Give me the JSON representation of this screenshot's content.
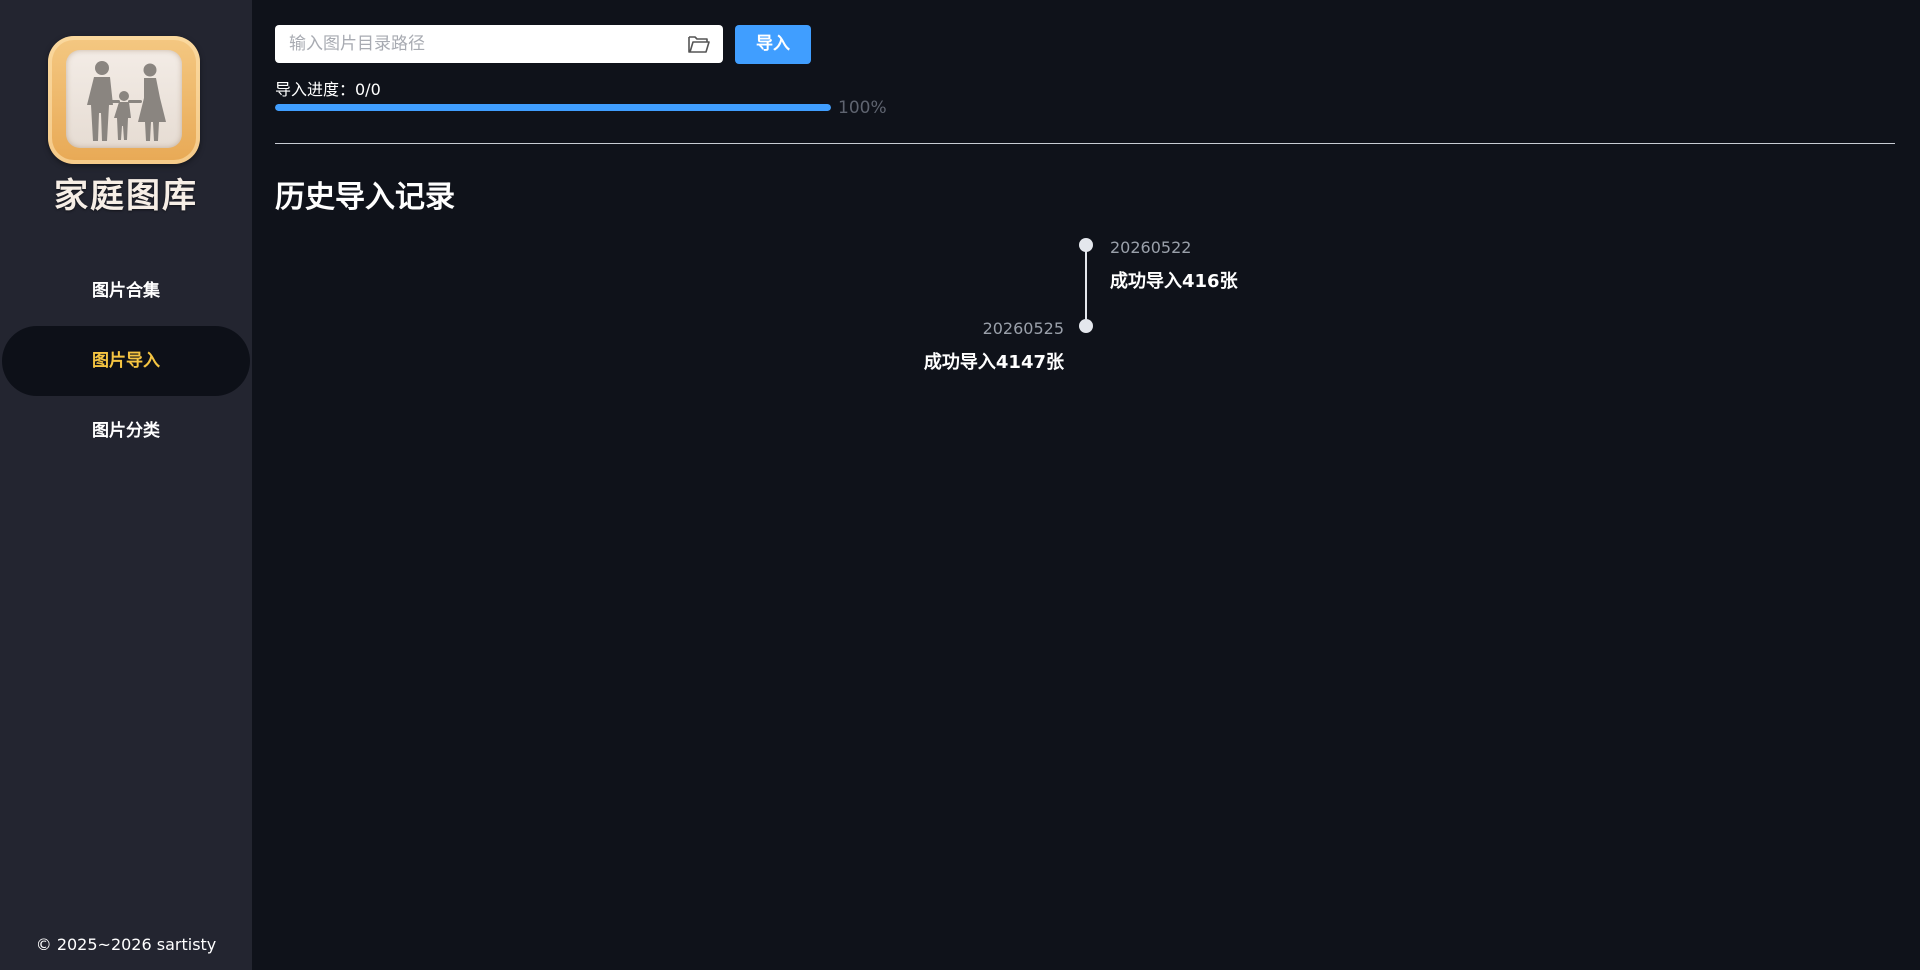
{
  "sidebar": {
    "logo_text": "家庭图库",
    "nav": [
      {
        "label": "图片合集",
        "active": false
      },
      {
        "label": "图片导入",
        "active": true
      },
      {
        "label": "图片分类",
        "active": false
      }
    ],
    "copyright": "© 2025~2026 sartisty"
  },
  "import": {
    "placeholder": "输入图片目录路径",
    "value": "",
    "folder_icon": "folder-open-icon",
    "button_label": "导入"
  },
  "progress": {
    "label": "导入进度：0/0",
    "percent_text": "100%",
    "fraction": 1.0
  },
  "history": {
    "title": "历史导入记录",
    "records": [
      {
        "date": "20260522",
        "text": "成功导入416张"
      },
      {
        "date": "20260525",
        "text": "成功导入4147张"
      }
    ]
  },
  "colors": {
    "accent": "#409eff",
    "active_nav": "#f5c542",
    "sidebar_bg": "#232530",
    "main_bg": "#0f121a"
  }
}
